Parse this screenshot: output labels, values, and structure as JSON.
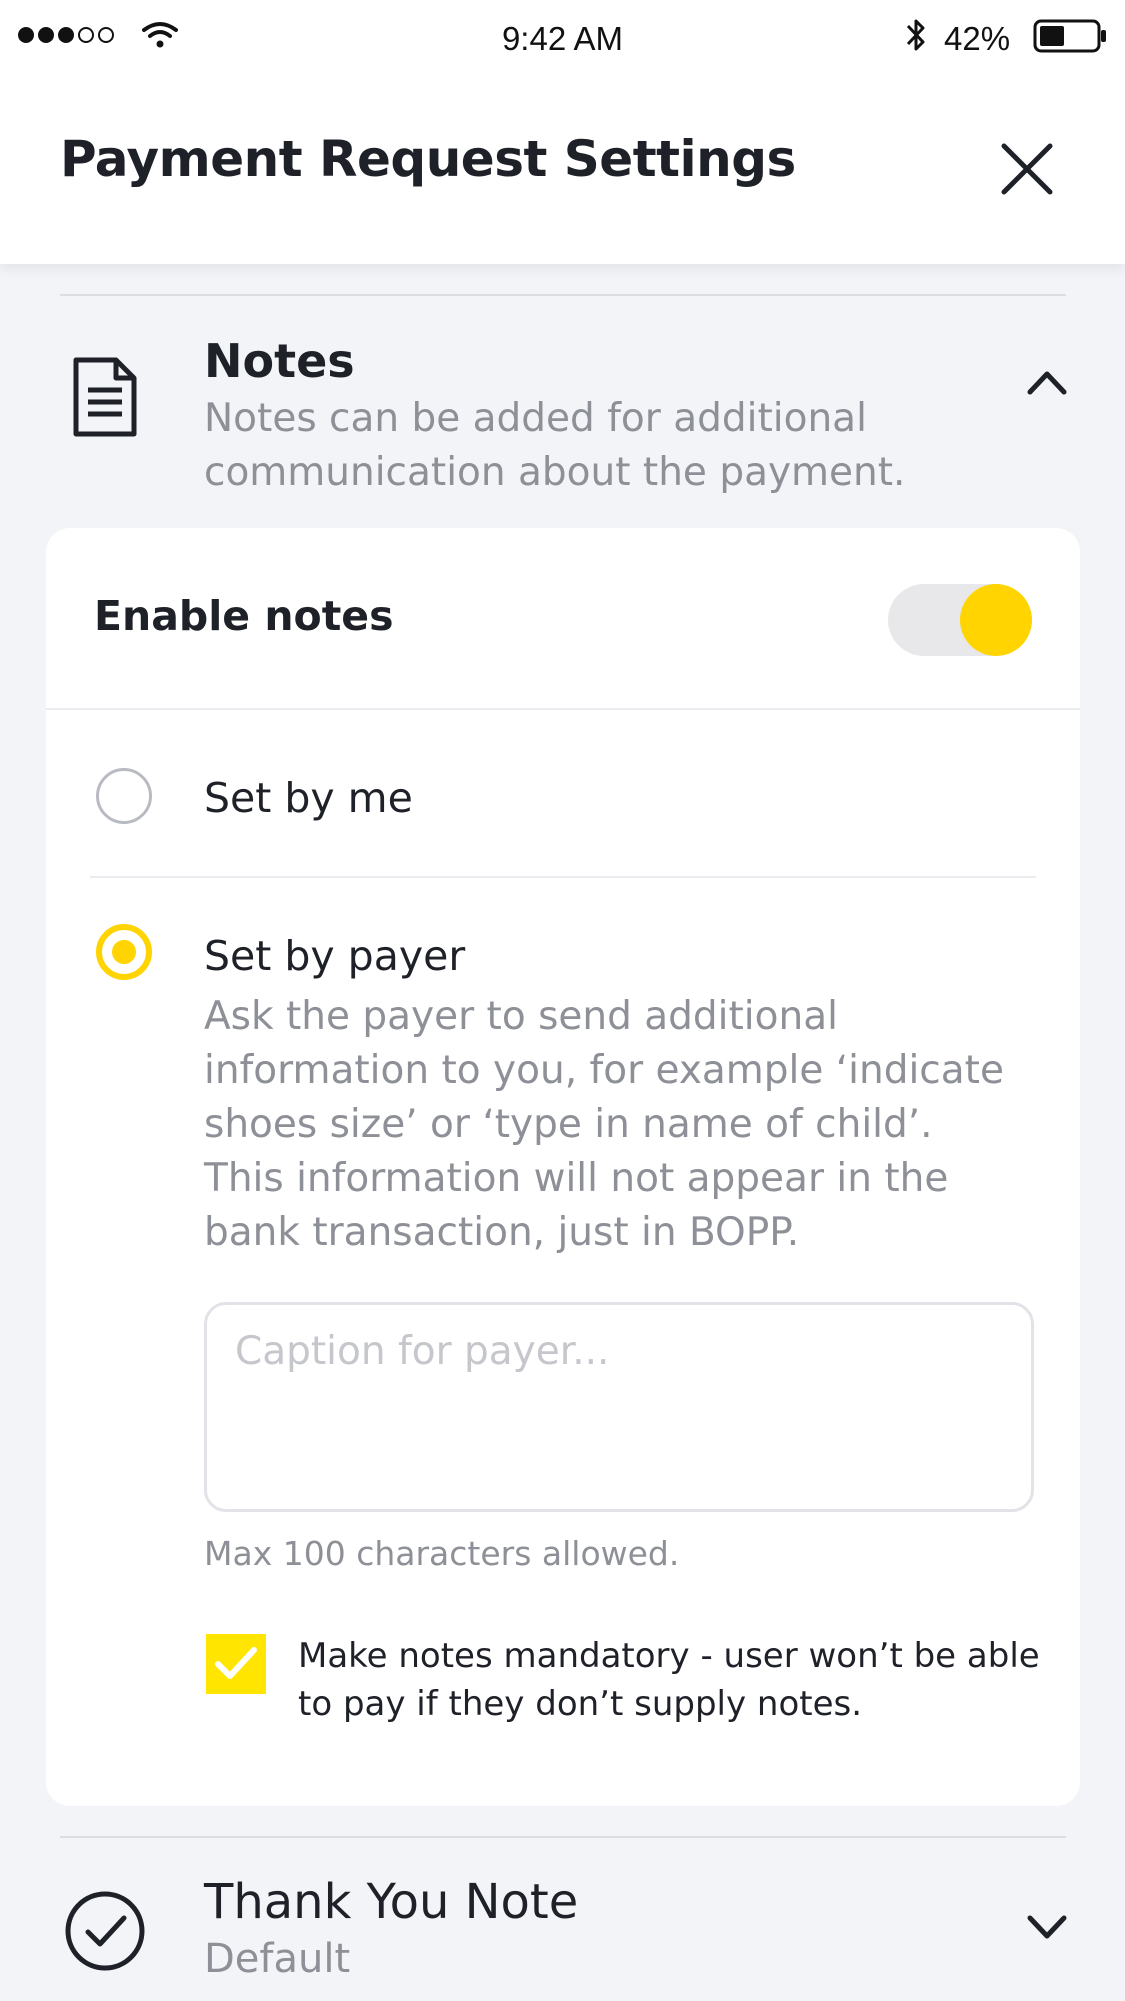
{
  "status_bar": {
    "time": "9:42 AM",
    "battery_percent": "42%",
    "signal_bars_filled": 3,
    "signal_bars_total": 5,
    "battery_level": 0.42,
    "icons": [
      "signal-dots",
      "wifi-icon",
      "bluetooth-icon",
      "battery-icon"
    ]
  },
  "header": {
    "title": "Payment Request Settings",
    "close_icon": "close-icon"
  },
  "notes_section": {
    "icon": "document-icon",
    "title": "Notes",
    "description": "Notes can be added for additional communication about the payment.",
    "expanded": true,
    "chevron_icon": "chevron-up-icon"
  },
  "notes_card": {
    "enable_label": "Enable notes",
    "enabled": true,
    "options": [
      {
        "label": "Set by me",
        "selected": false
      },
      {
        "label": "Set by payer",
        "selected": true
      }
    ],
    "payer_description": "Ask the payer to send additional information to you, for example ‘indicate shoes size’ or ‘type in name of child’. This information will not appear in the bank transaction, just in BOPP.",
    "caption_value": "",
    "caption_placeholder": "Caption for payer...",
    "max_chars_text": "Max 100 characters allowed.",
    "mandatory_checked": true,
    "mandatory_text": "Make notes mandatory - user won’t be able to pay if they don’t supply notes."
  },
  "thank_you_section": {
    "icon": "check-circle-icon",
    "title": "Thank You Note",
    "subtitle": "Default",
    "chevron_icon": "chevron-down-icon"
  },
  "colors": {
    "accent_yellow": "#ffd400",
    "checkbox_yellow": "#ffe500",
    "background": "#f3f4f8",
    "text_primary": "#1f2129",
    "text_secondary": "#8e9097"
  }
}
